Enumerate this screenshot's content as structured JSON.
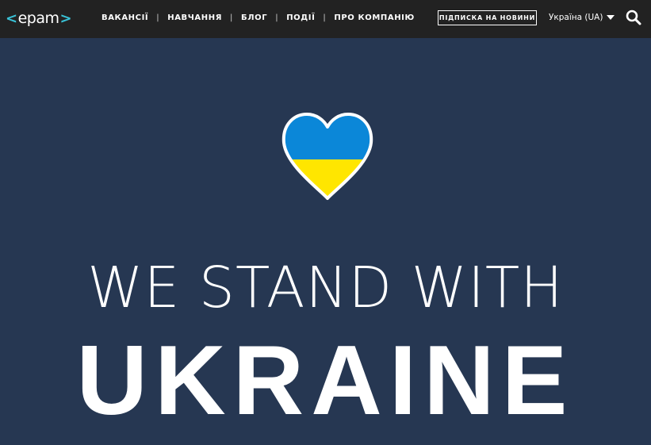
{
  "header": {
    "logo_text": "epam",
    "nav": [
      {
        "label": "ВАКАНСІЇ"
      },
      {
        "label": "НАВЧАННЯ"
      },
      {
        "label": "БЛОГ"
      },
      {
        "label": "ПОДІЇ"
      },
      {
        "label": "ПРО КОМПАНІЮ"
      }
    ],
    "nav_separator": "|",
    "subscribe_label": "ПІДПИСКА НА НОВИНИ",
    "region_label": "Україна (UA)",
    "search_icon": "search-icon"
  },
  "hero": {
    "line1": "WE STAND WITH",
    "line2": "UKRAINE",
    "heart_icon": "ukraine-heart-icon"
  },
  "colors": {
    "header_bg": "#222222",
    "hero_bg": "#263752",
    "logo_accent": "#39c2d7",
    "flag_blue": "#0b87d8",
    "flag_yellow": "#ffe600"
  }
}
